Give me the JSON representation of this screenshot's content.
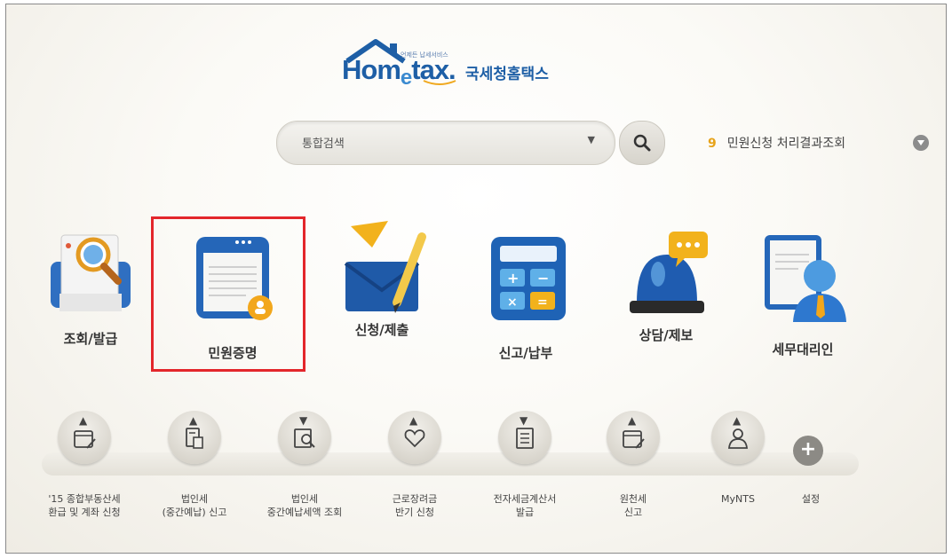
{
  "logo": {
    "brand_home": "Hom",
    "brand_e": "e",
    "brand_tax": "tax.",
    "korean": "국세청홈택스",
    "tagline": "언제든 납세서비스"
  },
  "search": {
    "label": "통합검색",
    "caret": "▼"
  },
  "status": {
    "count": "9",
    "text": "민원신청 처리결과조회"
  },
  "menu": [
    {
      "label": "조회/발급",
      "icon": "search-document-icon"
    },
    {
      "label": "민원증명",
      "icon": "certificate-icon"
    },
    {
      "label": "신청/제출",
      "icon": "envelope-pencil-icon"
    },
    {
      "label": "신고/납부",
      "icon": "calculator-icon"
    },
    {
      "label": "상담/제보",
      "icon": "siren-chat-icon"
    },
    {
      "label": "세무대리인",
      "icon": "tax-agent-icon"
    }
  ],
  "quick": [
    {
      "label": "'15 종합부동산세\n환급 및 계좌 신청",
      "icon": "calendar-pen-icon"
    },
    {
      "label": "법인세\n(중간예납) 신고",
      "icon": "document-icon"
    },
    {
      "label": "법인세\n중간예납세액 조회",
      "icon": "report-search-icon"
    },
    {
      "label": "근로장려금\n반기 신청",
      "icon": "heart-icon"
    },
    {
      "label": "전자세금계산서\n발급",
      "icon": "invoice-icon"
    },
    {
      "label": "원천세\n신고",
      "icon": "calendar-pen-icon"
    },
    {
      "label": "MyNTS",
      "icon": "person-icon"
    },
    {
      "label": "설정",
      "icon": "plus-icon"
    }
  ],
  "colors": {
    "highlight": "#e3262b",
    "brand": "#1e5fa6",
    "count": "#e7a31a"
  }
}
